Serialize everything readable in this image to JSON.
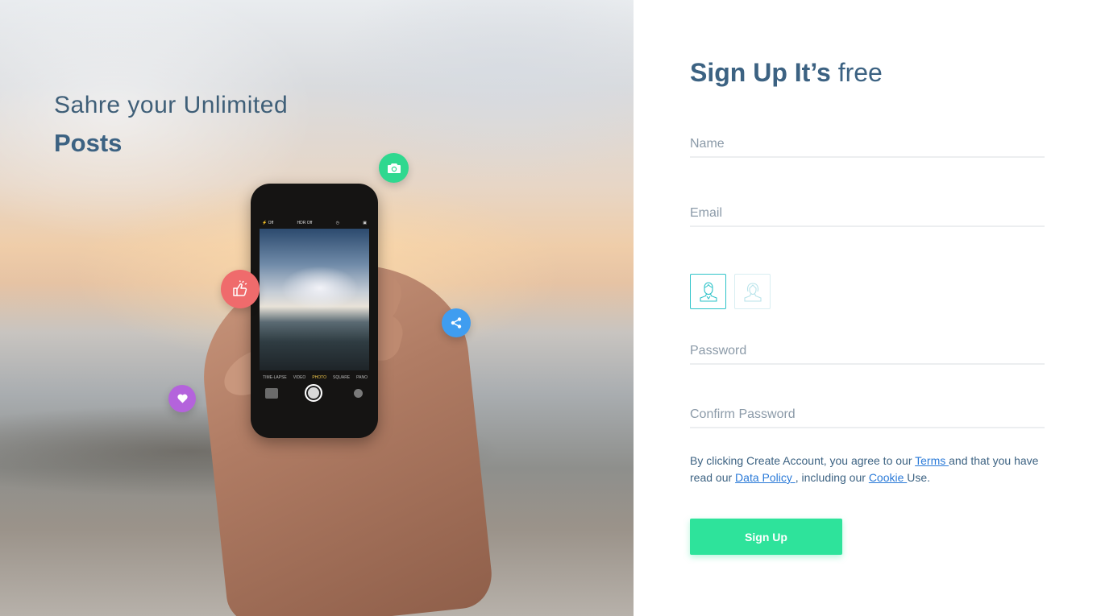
{
  "hero": {
    "line1": "Sahre your Unlimited",
    "line2": "Posts",
    "badges": [
      {
        "name": "camera-icon",
        "color": "#2fd88f"
      },
      {
        "name": "thumbs-up-icon",
        "color": "#ef6b6c"
      },
      {
        "name": "share-icon",
        "color": "#3f9df0"
      },
      {
        "name": "heart-icon",
        "color": "#b463dc"
      }
    ],
    "phone": {
      "status_left": "⚡ Off",
      "status_mid": "HDR Off",
      "modes": [
        "TIME-LAPSE",
        "VIDEO",
        "PHOTO",
        "SQUARE",
        "PANO"
      ],
      "active_mode": "PHOTO"
    }
  },
  "form": {
    "title_bold": "Sign Up It’s",
    "title_light": "free",
    "name_placeholder": "Name",
    "email_placeholder": "Email",
    "password_placeholder": "Password",
    "confirm_placeholder": "Confirm Password",
    "gender_options": [
      "male-avatar-icon",
      "female-avatar-icon"
    ],
    "terms": {
      "t1": "By clicking Create Account, you agree to our ",
      "terms_link": "Terms ",
      "t2": "and that you have read our ",
      "data_policy_link": "Data Policy ",
      "t3": ", including our ",
      "cookie_link": "Cookie ",
      "t4": "Use."
    },
    "submit_label": "Sign Up"
  },
  "colors": {
    "accent": "#2ee39b",
    "title": "#3c6282",
    "link": "#2a7ad8"
  }
}
